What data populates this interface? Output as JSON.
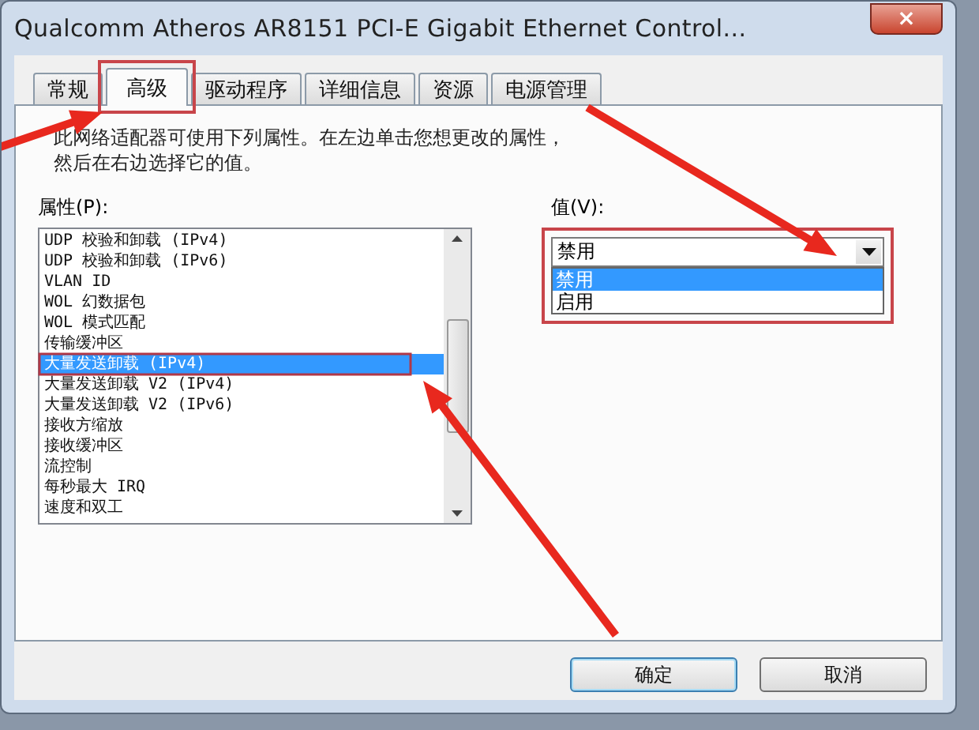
{
  "window": {
    "title": "Qualcomm Atheros AR8151 PCI-E Gigabit Ethernet Control...",
    "close": "×"
  },
  "tabs": [
    {
      "label": "常规",
      "selected": false
    },
    {
      "label": "高级",
      "selected": true
    },
    {
      "label": "驱动程序",
      "selected": false
    },
    {
      "label": "详细信息",
      "selected": false
    },
    {
      "label": "资源",
      "selected": false
    },
    {
      "label": "电源管理",
      "selected": false
    }
  ],
  "description": "此网络适配器可使用下列属性。在左边单击您想更改的属性，然后在右边选择它的值。",
  "properties": {
    "label": "属性(P):",
    "items": [
      {
        "label": "UDP 校验和卸载 (IPv4)",
        "selected": false
      },
      {
        "label": "UDP 校验和卸载 (IPv6)",
        "selected": false
      },
      {
        "label": "VLAN ID",
        "selected": false
      },
      {
        "label": "WOL 幻数据包",
        "selected": false
      },
      {
        "label": "WOL 模式匹配",
        "selected": false
      },
      {
        "label": "传输缓冲区",
        "selected": false
      },
      {
        "label": "大量发送卸载 (IPv4)",
        "selected": true
      },
      {
        "label": "大量发送卸载 V2 (IPv4)",
        "selected": false
      },
      {
        "label": "大量发送卸载 V2 (IPv6)",
        "selected": false
      },
      {
        "label": "接收方缩放",
        "selected": false
      },
      {
        "label": "接收缓冲区",
        "selected": false
      },
      {
        "label": "流控制",
        "selected": false
      },
      {
        "label": "每秒最大 IRQ",
        "selected": false
      },
      {
        "label": "速度和双工",
        "selected": false
      }
    ]
  },
  "value": {
    "label": "值(V):",
    "current": "禁用",
    "expanded": true,
    "options": [
      {
        "label": "禁用",
        "selected": true
      },
      {
        "label": "启用",
        "selected": false
      }
    ]
  },
  "buttons": [
    {
      "label": "确定",
      "kind": "default"
    },
    {
      "label": "取消",
      "kind": "normal"
    }
  ]
}
